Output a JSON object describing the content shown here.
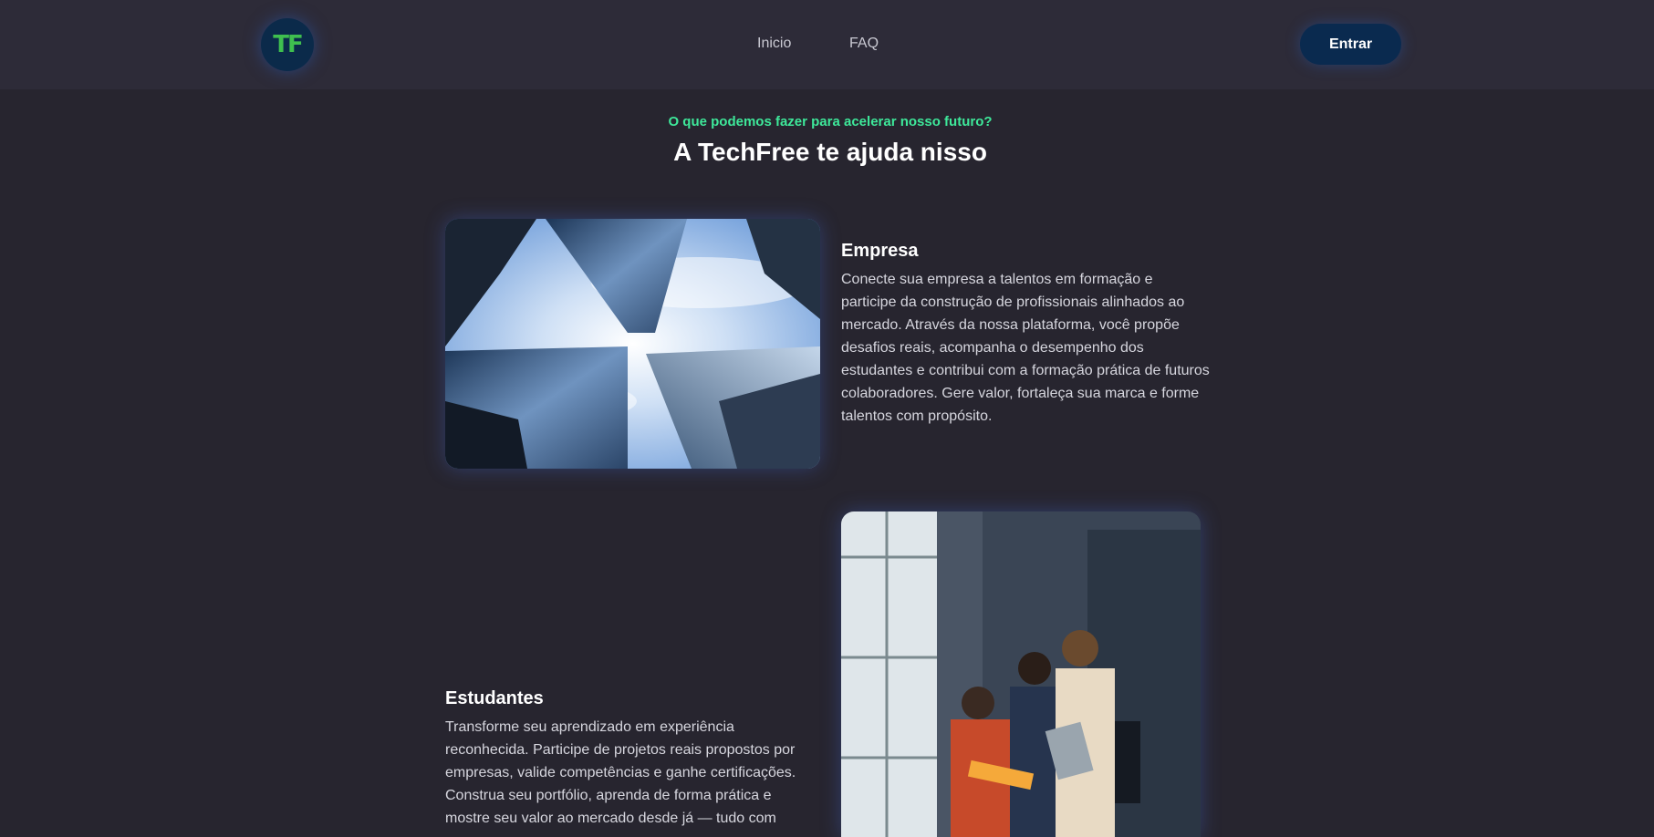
{
  "header": {
    "logo_text": "TF",
    "nav": [
      {
        "label": "Inicio"
      },
      {
        "label": "FAQ"
      }
    ],
    "login_label": "Entrar"
  },
  "intro": {
    "eyebrow": "O que podemos fazer para acelerar nosso futuro?",
    "headline": "A TechFree te ajuda nisso"
  },
  "sections": [
    {
      "title": "Empresa",
      "text": "Conecte sua empresa a talentos em formação e participe da construção de profissionais alinhados ao mercado. Através da nossa plataforma, você propõe desafios reais, acompanha o desempenho dos estudantes e contribui com a formação prática de futuros colaboradores. Gere valor, fortaleça sua marca e forme talentos com propósito.",
      "image": "skyscrapers-photo"
    },
    {
      "title": "Estudantes",
      "text": "Transforme seu aprendizado em experiência reconhecida. Participe de projetos reais propostos por empresas, valide competências e ganhe certificações. Construa seu portfólio, aprenda de forma prática e mostre seu valor ao mercado desde já — tudo com",
      "image": "students-photo"
    }
  ],
  "colors": {
    "background": "#27252f",
    "header": "#2d2b38",
    "accent": "#3ee89a",
    "button": "#0a2a4f"
  }
}
